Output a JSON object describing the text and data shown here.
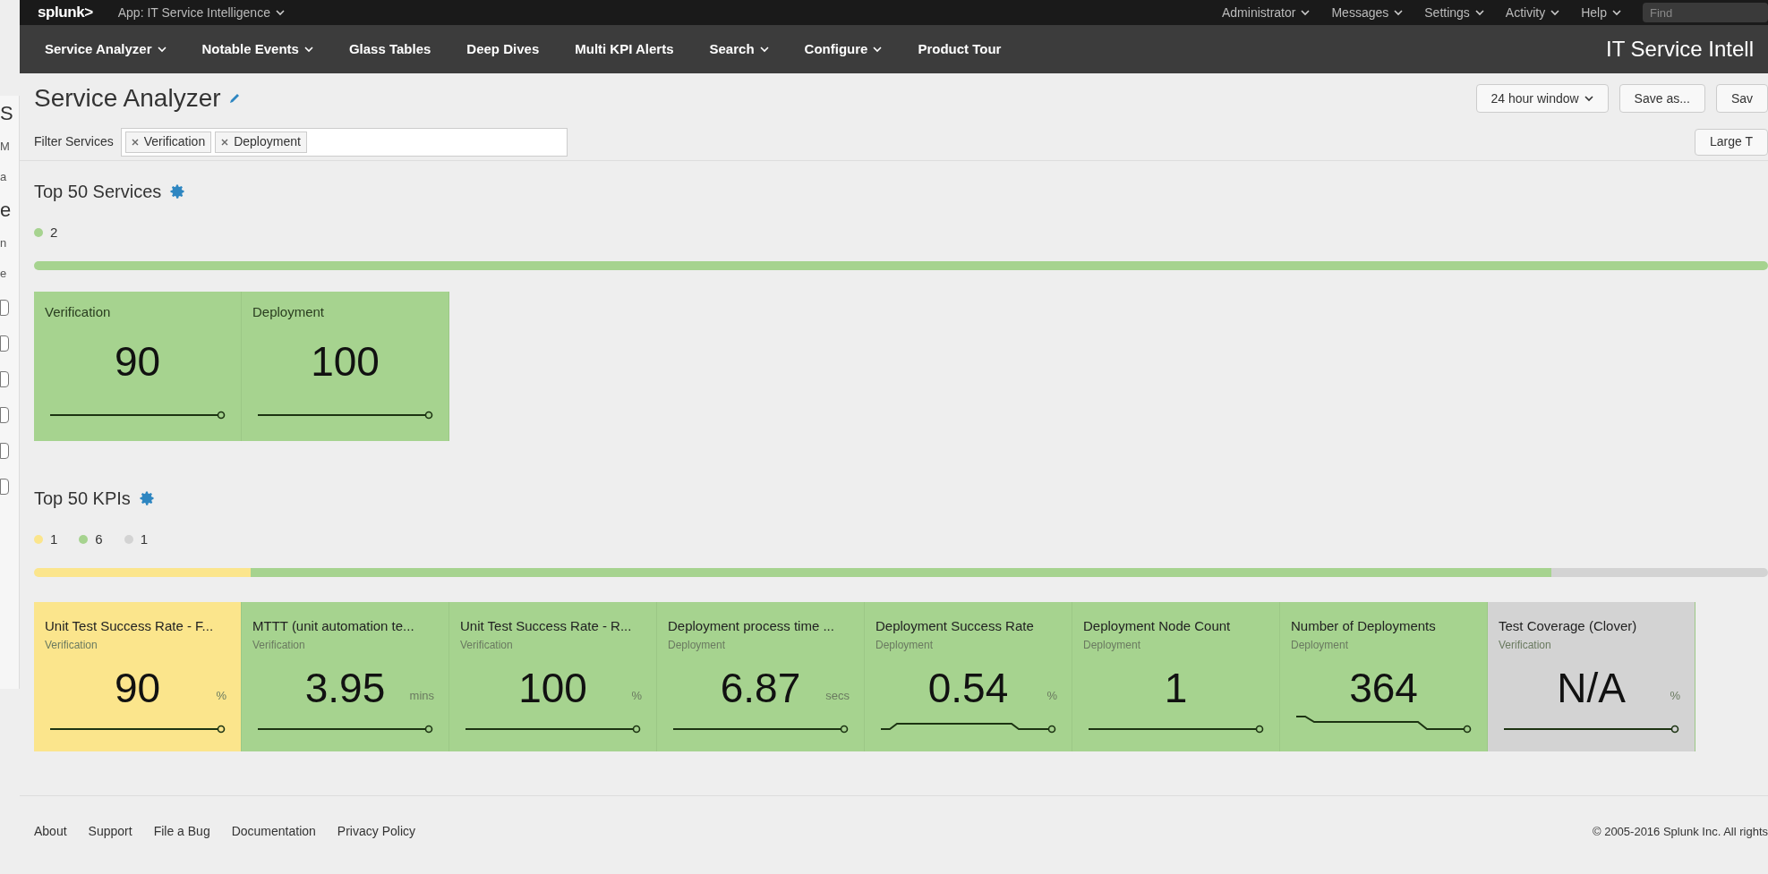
{
  "background_window": {
    "fragments": [
      "S",
      "M",
      "a",
      "e",
      "n",
      "e"
    ],
    "checkboxes": [
      {
        "checked": false
      },
      {
        "checked": false
      },
      {
        "checked": false
      },
      {
        "checked": false
      },
      {
        "checked": false
      },
      {
        "checked": false
      }
    ]
  },
  "top_bar": {
    "logo": "splunk>",
    "app": "App: IT Service Intelligence",
    "menus": [
      "Administrator",
      "Messages",
      "Settings",
      "Activity",
      "Help"
    ],
    "search": {
      "placeholder": "Find"
    }
  },
  "nav": {
    "items": [
      {
        "label": "Service Analyzer",
        "dropdown": true
      },
      {
        "label": "Notable Events",
        "dropdown": true
      },
      {
        "label": "Glass Tables",
        "dropdown": false
      },
      {
        "label": "Deep Dives",
        "dropdown": false
      },
      {
        "label": "Multi KPI Alerts",
        "dropdown": false
      },
      {
        "label": "Search",
        "dropdown": true
      },
      {
        "label": "Configure",
        "dropdown": true
      },
      {
        "label": "Product Tour",
        "dropdown": false
      }
    ],
    "app_title": "IT Service Intell"
  },
  "header": {
    "title": "Service Analyzer",
    "buttons": [
      {
        "label": "24 hour window",
        "dropdown": true
      },
      {
        "label": "Save as...",
        "dropdown": false
      },
      {
        "label": "Sav",
        "dropdown": false
      }
    ]
  },
  "filter": {
    "label": "Filter Services",
    "tokens": [
      "Verification",
      "Deployment"
    ],
    "view_button": "Large T"
  },
  "services": {
    "title": "Top 50 Services",
    "legend": [
      {
        "count": "2",
        "color": "#a6d38f"
      }
    ],
    "tiles": [
      {
        "name": "Verification",
        "value": "90",
        "color": "#a6d38f",
        "kind": "flat"
      },
      {
        "name": "Deployment",
        "value": "100",
        "color": "#a6d38f",
        "kind": "flat"
      }
    ]
  },
  "kpis": {
    "title": "Top 50 KPIs",
    "legend": [
      {
        "count": "1",
        "color": "#fbe58c"
      },
      {
        "count": "6",
        "color": "#a6d38f"
      },
      {
        "count": "1",
        "color": "#d3d3d3"
      }
    ],
    "tiles": [
      {
        "name": "Unit Test Success Rate - F...",
        "service": "Verification",
        "value": "90",
        "unit": "%",
        "color": "#fbe58c",
        "kind": "flat"
      },
      {
        "name": "MTTT (unit automation te...",
        "service": "Verification",
        "value": "3.95",
        "unit": "mins",
        "color": "#a6d38f",
        "kind": "flat"
      },
      {
        "name": "Unit Test Success Rate - R...",
        "service": "Verification",
        "value": "100",
        "unit": "%",
        "color": "#a6d38f",
        "kind": "flat"
      },
      {
        "name": "Deployment process time ...",
        "service": "Deployment",
        "value": "6.87",
        "unit": "secs",
        "color": "#a6d38f",
        "kind": "flat"
      },
      {
        "name": "Deployment Success Rate",
        "service": "Deployment",
        "value": "0.54",
        "unit": "%",
        "color": "#a6d38f",
        "kind": "bump"
      },
      {
        "name": "Deployment Node Count",
        "service": "Deployment",
        "value": "1",
        "color": "#a6d38f",
        "kind": "flat"
      },
      {
        "name": "Number of Deployments",
        "service": "Deployment",
        "value": "364",
        "color": "#a6d38f",
        "kind": "down"
      },
      {
        "name": "Test Coverage (Clover)",
        "service": "Verification",
        "value": "N/A",
        "unit": "%",
        "color": "#d3d3d3",
        "kind": "flat"
      }
    ]
  },
  "footer": {
    "links": [
      "About",
      "Support",
      "File a Bug",
      "Documentation",
      "Privacy Policy"
    ],
    "copyright": "© 2005-2016 Splunk Inc. All rights"
  }
}
